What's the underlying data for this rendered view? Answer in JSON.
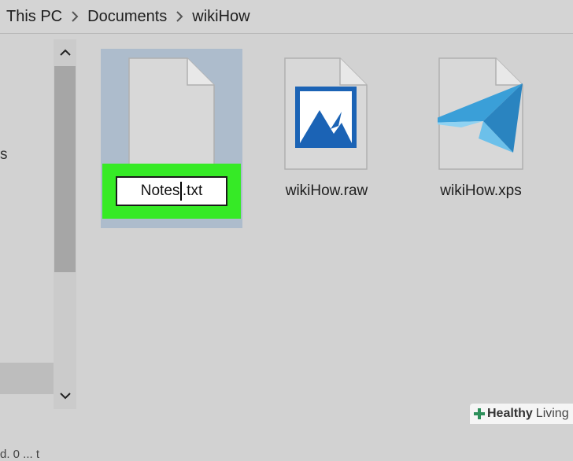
{
  "breadcrumb": {
    "items": [
      "This PC",
      "Documents",
      "wikiHow"
    ]
  },
  "navpane": {
    "partial_text": "s",
    "bottom_partial_text": "d. 0 ... t"
  },
  "files": [
    {
      "name": "Notes",
      "ext": ".txt",
      "type": "text",
      "selected": true,
      "renaming": true
    },
    {
      "name": "wikiHow.raw",
      "type": "image"
    },
    {
      "name": "wikiHow.xps",
      "type": "xps"
    }
  ],
  "watermark": {
    "brand": "Healthy",
    "suffix": "Living"
  },
  "colors": {
    "selection": "#adbccc",
    "rename_highlight": "#36ea26",
    "image_icon_blue": "#1b63b5",
    "xps_blue": "#3a9fd8"
  },
  "icons": [
    "chevron-right-icon",
    "chevron-up-icon",
    "chevron-down-icon",
    "text-file-icon",
    "image-file-icon",
    "xps-file-icon",
    "health-plus-icon"
  ]
}
